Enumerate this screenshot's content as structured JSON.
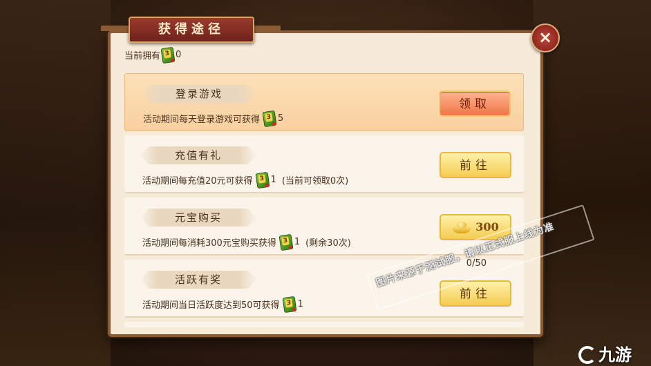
{
  "window": {
    "title": "获得途径",
    "close_glyph": "×"
  },
  "owned": {
    "label": "当前拥有",
    "token_digit": "3",
    "value": "0"
  },
  "items": [
    {
      "name": "登录游戏",
      "desc_prefix": "活动期间每天登录游戏可获得",
      "amount": "5",
      "suffix": "",
      "button_label": "领取",
      "button_type": "claim"
    },
    {
      "name": "充值有礼",
      "desc_prefix": "活动期间每充值20元可获得",
      "amount": "1",
      "suffix": "(当前可领取0次)",
      "button_label": "前往",
      "button_type": "go"
    },
    {
      "name": "元宝购买",
      "desc_prefix": "活动期间每消耗300元宝购买获得",
      "amount": "1",
      "suffix": "(剩余30次)",
      "button_label": "300",
      "button_type": "ingot",
      "button_icon": "gold-ingot-icon"
    },
    {
      "name": "活跃有奖",
      "desc_prefix": "活动期间当日活跃度达到50可获得",
      "amount": "1",
      "suffix": "",
      "button_label": "前往",
      "button_type": "go",
      "progress": "0/50"
    }
  ],
  "watermark": "图片来源于测试服，请以正式服上线为准",
  "brand": "九游",
  "colors": {
    "panel_bg": "#f6ead8",
    "title_plate": "#9a3a2e",
    "claim_button": "#f17448",
    "go_button": "#f4cc52",
    "token_green": "#4e9c22"
  }
}
